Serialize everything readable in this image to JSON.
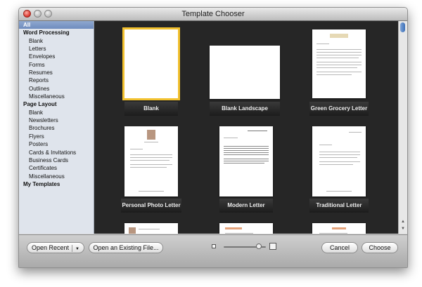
{
  "window": {
    "title": "Template Chooser"
  },
  "sidebar": {
    "items": [
      {
        "label": "All",
        "kind": "selected"
      },
      {
        "label": "Word Processing",
        "kind": "header"
      },
      {
        "label": "Blank",
        "kind": "sub"
      },
      {
        "label": "Letters",
        "kind": "sub"
      },
      {
        "label": "Envelopes",
        "kind": "sub"
      },
      {
        "label": "Forms",
        "kind": "sub"
      },
      {
        "label": "Resumes",
        "kind": "sub"
      },
      {
        "label": "Reports",
        "kind": "sub"
      },
      {
        "label": "Outlines",
        "kind": "sub"
      },
      {
        "label": "Miscellaneous",
        "kind": "sub"
      },
      {
        "label": "Page Layout",
        "kind": "header"
      },
      {
        "label": "Blank",
        "kind": "sub"
      },
      {
        "label": "Newsletters",
        "kind": "sub"
      },
      {
        "label": "Brochures",
        "kind": "sub"
      },
      {
        "label": "Flyers",
        "kind": "sub"
      },
      {
        "label": "Posters",
        "kind": "sub"
      },
      {
        "label": "Cards & Invitations",
        "kind": "sub"
      },
      {
        "label": "Business Cards",
        "kind": "sub"
      },
      {
        "label": "Certificates",
        "kind": "sub"
      },
      {
        "label": "Miscellaneous",
        "kind": "sub"
      },
      {
        "label": "My Templates",
        "kind": "header"
      }
    ]
  },
  "templates": [
    {
      "label": "Blank",
      "selected": true
    },
    {
      "label": "Blank Landscape"
    },
    {
      "label": "Green Grocery Letter"
    },
    {
      "label": "Personal Photo Letter"
    },
    {
      "label": "Modern Letter"
    },
    {
      "label": "Traditional Letter"
    }
  ],
  "toolbar": {
    "open_recent": "Open Recent",
    "open_existing": "Open an Existing File...",
    "cancel": "Cancel",
    "choose": "Choose"
  },
  "colors": {
    "selection_outline": "#f2c12e",
    "grid_bg": "#262626",
    "sidebar_selected": "#7b96c5"
  }
}
